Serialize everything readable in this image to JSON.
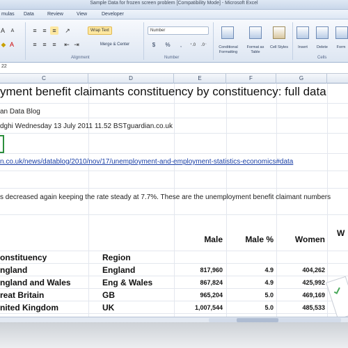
{
  "window": {
    "title": "Sample Data for frozen screen problem  [Compatibility Mode] - Microsoft Excel"
  },
  "menu": {
    "tabs": [
      "mulas",
      "Data",
      "Review",
      "View",
      "Developer"
    ]
  },
  "ribbon": {
    "wrap_text": "Wrap Text",
    "merge_center": "Merge & Center",
    "number_format": "Number",
    "currency": "$",
    "percent": "%",
    "comma": ",",
    "conditional_formatting": "Conditional Formatting",
    "format_as_table": "Format as Table",
    "cell_styles": "Cell Styles",
    "insert": "Insert",
    "delete": "Delete",
    "format": "Form",
    "groups": {
      "alignment": "Alignment",
      "number": "Number",
      "cells": "Cells"
    }
  },
  "formula_bar": {
    "name_box": "22"
  },
  "columns": [
    "C",
    "D",
    "E",
    "F",
    "G"
  ],
  "sheet": {
    "title": "yment benefit claimants constituency by constituency: full data",
    "source": "an Data Blog",
    "byline": "dghi Wednesday 13 July 2011 11.52 BSTguardian.co.uk",
    "link": "n.co.uk/news/datablog/2010/nov/17/unemployment-and-employment-statistics-economics#data",
    "note": "s decreased again keeping the rate steady at 7.7%. These are the unemployment benefit claimant numbers",
    "headers": {
      "male": "Male",
      "male_pct": "Male %",
      "women": "Women",
      "cut": "W",
      "constituency": "onstituency",
      "region": "Region"
    },
    "rows": [
      {
        "name": "ngland",
        "region": "England",
        "male": "817,960",
        "male_pct": "4.9",
        "women": "404,262"
      },
      {
        "name": "ngland and Wales",
        "region": "Eng & Wales",
        "male": "867,824",
        "male_pct": "4.9",
        "women": "425,992"
      },
      {
        "name": "reat Britain",
        "region": "GB",
        "male": "965,204",
        "male_pct": "5.0",
        "women": "469,169"
      },
      {
        "name": "nited Kingdom",
        "region": "UK",
        "male": "1,007,544",
        "male_pct": "5.0",
        "women": "485,533"
      }
    ]
  }
}
